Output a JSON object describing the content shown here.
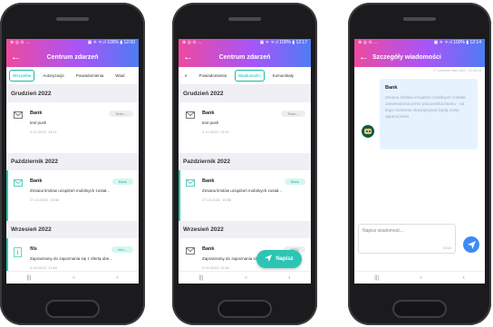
{
  "colors": {
    "gradient_start": "#ed4aa0",
    "gradient_end": "#4f7cf3",
    "accent": "#2cc5b3",
    "send_button": "#3d8bf7"
  },
  "screens": [
    {
      "status": {
        "left": "⊕ ◎ ⊙ …",
        "right": "▣ ✈ ᯤ.ıl 100% ▮ 12:00"
      },
      "title": "Centrum zdarzeń",
      "tabs": [
        "Wszystkie",
        "Autoryzacje",
        "Powiadomienia",
        "Wiad"
      ],
      "active_tab": 0,
      "sections": [
        {
          "header": "Grudzień 2022",
          "items": [
            {
              "icon": "envelope-icon",
              "sender": "Bank",
              "text": "test push",
              "date": "2.12.2022, 13:11",
              "badge": "Testo...",
              "badge_color": "grey"
            }
          ]
        },
        {
          "header": "Październik 2022",
          "items": [
            {
              "icon": "envelope-icon",
              "sender": "Bank",
              "text": "Zmiana limitów urządzeń mobilnych został...",
              "date": "27.10.2022, 15:56",
              "badge": "Bank",
              "badge_color": "green"
            }
          ]
        },
        {
          "header": "Wrzesień 2022",
          "items": [
            {
              "icon": "info-document-icon",
              "sender": "fils",
              "text": "Zapraszamy do zapoznania się z ofertą ube...",
              "date": "6.09.2022, 11:48",
              "badge": "Info...",
              "badge_color": "green"
            }
          ]
        }
      ]
    },
    {
      "status": {
        "left": "⊕ ◎ ⊙ …",
        "right": "▣ ✈ ᯤ.ıl 100% ▮ 12:17"
      },
      "title": "Centrum zdarzeń",
      "tabs": [
        "e",
        "Powiadomienia",
        "Wiadomości",
        "Komunikaty"
      ],
      "active_tab": 2,
      "sections": [
        {
          "header": "Grudzień 2022",
          "items": [
            {
              "icon": "envelope-icon",
              "sender": "Bank",
              "text": "test push",
              "date": "2.12.2022, 13:11",
              "badge": "Testo...",
              "badge_color": "grey"
            }
          ]
        },
        {
          "header": "Październik 2022",
          "items": [
            {
              "icon": "envelope-icon",
              "sender": "Bank",
              "text": "Zmiana limitów urządzeń mobilnych został...",
              "date": "27.10.2022, 15:56",
              "badge": "Bank",
              "badge_color": "green"
            }
          ]
        },
        {
          "header": "Wrzesień 2022",
          "items": [
            {
              "icon": "envelope-icon",
              "sender": "Bank",
              "text": "Zapraszamy do zapoznania się z ofertą ube...",
              "date": "6.09.2022, 11:48",
              "badge": "INFO",
              "badge_color": "grey"
            }
          ]
        }
      ],
      "fab_label": "Napisz"
    },
    {
      "status": {
        "left": "⊕ ◎ ⊙ …",
        "right": "▣ ✈ ᯤ.ıl 100% ▮ 12:14"
      },
      "title": "Szczegóły wiadomości",
      "message": {
        "time": "27 października 2022, 15:56:16",
        "sender": "Bank",
        "body": "Zmiana limitów urządzeń mobilnych została zatwierdzona przez pracownika banku - od tego momentu obowiązywać będą nowe ograniczenia"
      },
      "compose": {
        "placeholder": "Napisz wiadomość...",
        "counter": "0/240"
      }
    }
  ],
  "navbar": {
    "recents": "|||",
    "home": "○",
    "back": "‹"
  }
}
